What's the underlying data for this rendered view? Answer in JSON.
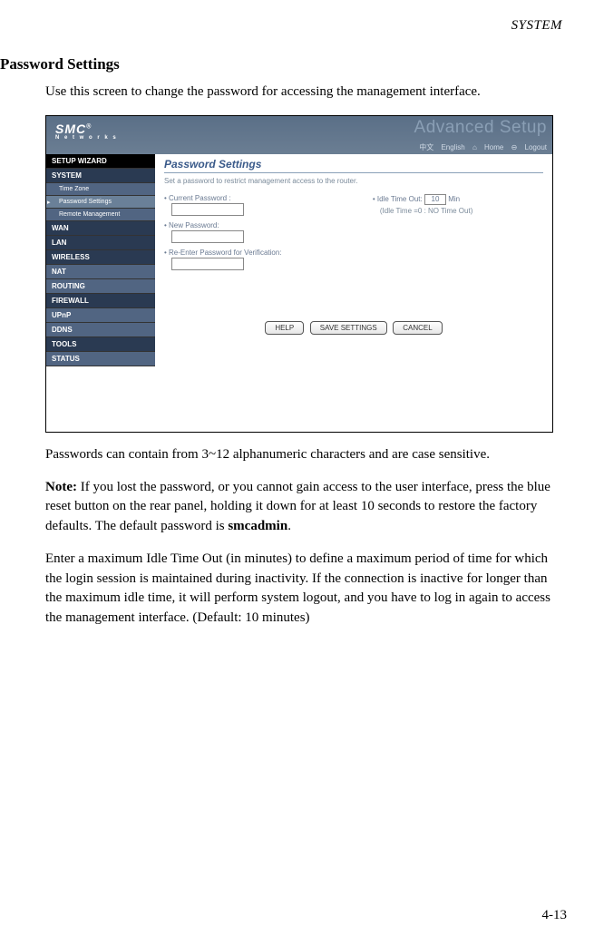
{
  "header": {
    "running_head": "SYSTEM"
  },
  "page": {
    "heading": "Password Settings",
    "intro": "Use this screen to change the password for accessing the management interface.",
    "after_shot": "Passwords can contain from 3~12 alphanumeric characters and are case sensitive.",
    "note_label": "Note:",
    "note_text_a": "If you lost the password, or you cannot gain access to the user interface, press the blue reset button on the rear panel, holding it down for at least 10 seconds to restore the factory defaults. The default password is ",
    "note_bold": "smcadmin",
    "note_text_b": ".",
    "idle_para": "Enter a maximum Idle Time Out (in minutes) to define a maximum period of time for which the login session is maintained during inactivity. If the connection is inactive for longer than the maximum idle time, it will perform system logout, and you have to log in again to access the management interface. (Default: 10 minutes)",
    "page_number": "4-13"
  },
  "screenshot": {
    "logo": "SMC",
    "logo_sub": "N e t w o r k s",
    "advanced": "Advanced Setup",
    "toplinks": {
      "lang1": "中文",
      "lang2": "English",
      "home": "Home",
      "logout": "Logout"
    },
    "nav": [
      {
        "label": "SETUP WIZARD",
        "cls": "black"
      },
      {
        "label": "SYSTEM",
        "cls": "dark"
      },
      {
        "label": "Time Zone",
        "cls": "mid sub"
      },
      {
        "label": "Password Settings",
        "cls": "sel sub"
      },
      {
        "label": "Remote Management",
        "cls": "mid sub"
      },
      {
        "label": "WAN",
        "cls": "dark"
      },
      {
        "label": "LAN",
        "cls": "dark"
      },
      {
        "label": "WIRELESS",
        "cls": "dark"
      },
      {
        "label": "NAT",
        "cls": "mid"
      },
      {
        "label": "ROUTING",
        "cls": "mid"
      },
      {
        "label": "FIREWALL",
        "cls": "dark"
      },
      {
        "label": "UPnP",
        "cls": "mid"
      },
      {
        "label": "DDNS",
        "cls": "mid"
      },
      {
        "label": "TOOLS",
        "cls": "dark"
      },
      {
        "label": "STATUS",
        "cls": "mid"
      }
    ],
    "panel": {
      "title": "Password Settings",
      "desc": "Set a password to restrict management access to the router.",
      "current_label": "Current Password :",
      "new_label": "New Password:",
      "reenter_label": "Re-Enter Password for Verification:",
      "idle_label": "Idle Time Out:",
      "idle_value": "10",
      "idle_unit": "Min",
      "idle_hint": "(Idle Time =0 : NO Time Out)",
      "buttons": {
        "help": "HELP",
        "save": "SAVE SETTINGS",
        "cancel": "CANCEL"
      }
    }
  }
}
